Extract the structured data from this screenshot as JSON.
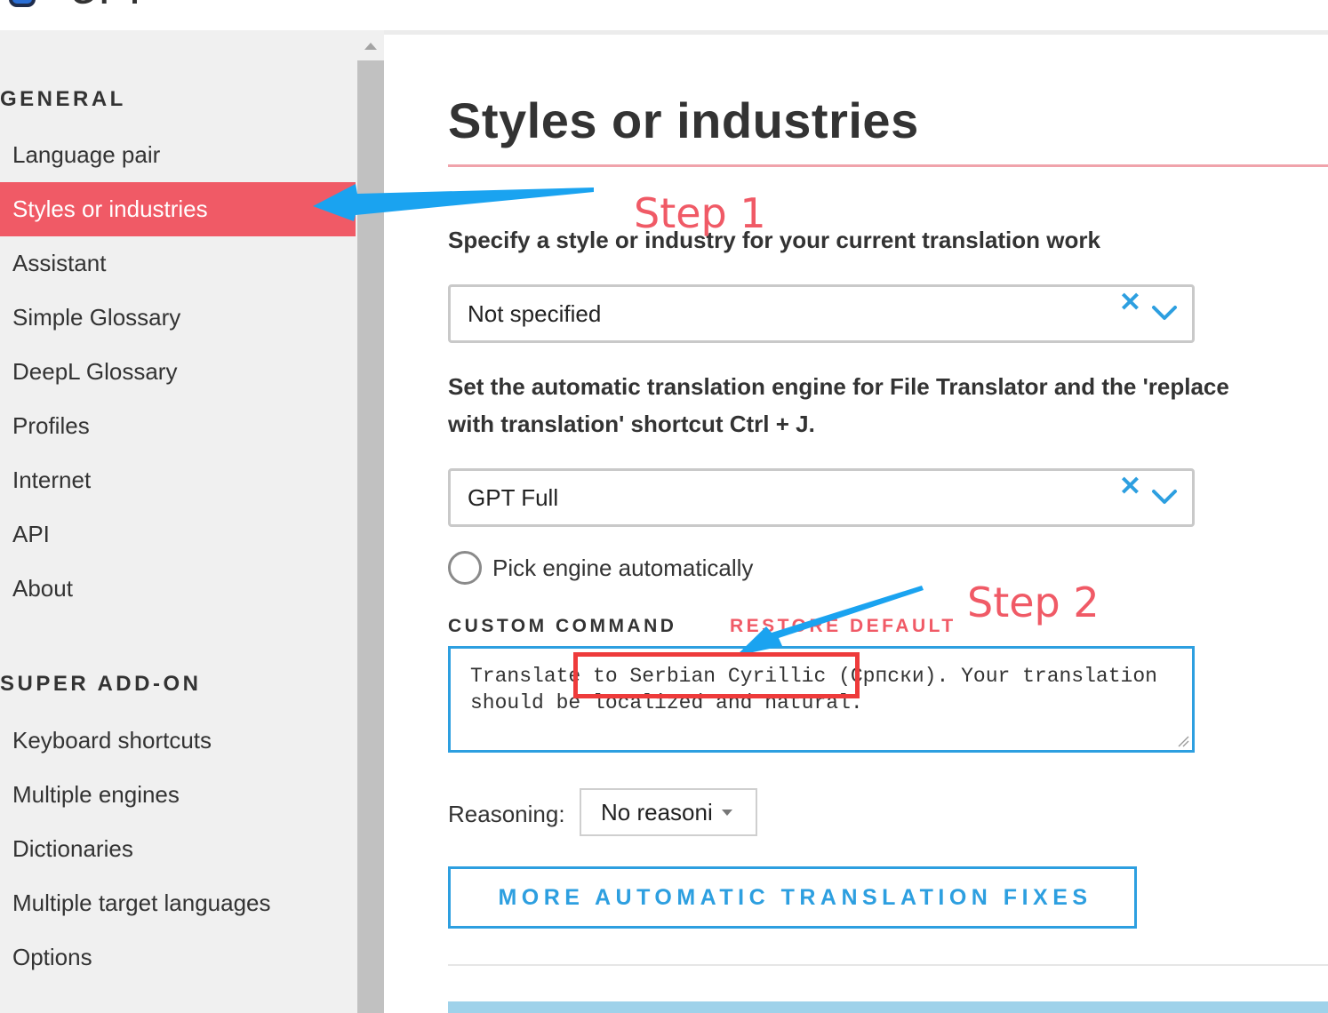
{
  "header": {
    "logo_text": "GPT"
  },
  "sidebar": {
    "sections": [
      {
        "heading": "GENERAL",
        "items": [
          {
            "label": "Language pair",
            "active": false
          },
          {
            "label": "Styles or industries",
            "active": true
          },
          {
            "label": "Assistant",
            "active": false
          },
          {
            "label": "Simple Glossary",
            "active": false
          },
          {
            "label": "DeepL Glossary",
            "active": false
          },
          {
            "label": "Profiles",
            "active": false
          },
          {
            "label": "Internet",
            "active": false
          },
          {
            "label": "API",
            "active": false
          },
          {
            "label": "About",
            "active": false
          }
        ]
      },
      {
        "heading": "SUPER ADD-ON",
        "items": [
          {
            "label": "Keyboard shortcuts",
            "active": false
          },
          {
            "label": "Multiple engines",
            "active": false
          },
          {
            "label": "Dictionaries",
            "active": false
          },
          {
            "label": "Multiple target languages",
            "active": false
          },
          {
            "label": "Options",
            "active": false
          }
        ]
      }
    ]
  },
  "main": {
    "title": "Styles or industries",
    "style_label": "Specify a style or industry for your current translation work",
    "style_select": {
      "value": "Not specified",
      "clear_icon": "x-icon",
      "open_icon": "chevron-down-icon"
    },
    "engine_label_line1": "Set the automatic translation engine for File Translator and the 'replace",
    "engine_label_line2": "with translation' shortcut Ctrl + J.",
    "engine_select": {
      "value": "GPT Full",
      "clear_icon": "x-icon",
      "open_icon": "chevron-down-icon"
    },
    "auto_pick": {
      "label": "Pick engine automatically",
      "checked": false
    },
    "custom_command": {
      "label": "CUSTOM COMMAND",
      "restore_label": "RESTORE DEFAULT",
      "value": "Translate to Serbian Cyrillic (Српски). Your translation should be localized and natural."
    },
    "reasoning": {
      "label": "Reasoning:",
      "value": "No reasoni"
    },
    "fixes_button": "MORE AUTOMATIC TRANSLATION FIXES"
  },
  "annotations": {
    "step1": "Step 1",
    "step2": "Step 2",
    "arrow_color": "#1aa3f0",
    "text_color": "#f05a66",
    "box_color": "#ee3b3b"
  },
  "colors": {
    "accent_red": "#f05a66",
    "accent_blue": "#2d9fe0"
  }
}
